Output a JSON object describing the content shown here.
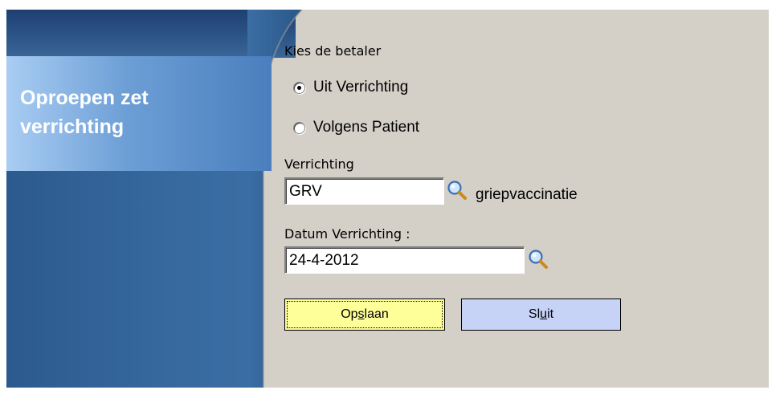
{
  "sidebar": {
    "title": "Oproepen zet verrichting"
  },
  "form": {
    "payer_label": "Kies de betaler",
    "payer_options": [
      {
        "label": "Uit Verrichting",
        "checked": true
      },
      {
        "label": "Volgens Patient",
        "checked": false
      }
    ],
    "verrichting_label": "Verrichting",
    "verrichting_value": "GRV",
    "verrichting_description": "griepvaccinatie",
    "datum_label": "Datum Verrichting :",
    "datum_value": "24-4-2012"
  },
  "buttons": {
    "save": {
      "before": "Op",
      "mnemonic": "s",
      "after": "laan"
    },
    "close": {
      "before": "Sl",
      "mnemonic": "u",
      "after": "it"
    }
  },
  "colors": {
    "sidebar_blue": "#386aa0",
    "panel_gray": "#d4d0c8",
    "save_button": "#ffff99",
    "close_button": "#c6d3f7"
  },
  "icons": {
    "lookup": "magnifier-icon"
  }
}
